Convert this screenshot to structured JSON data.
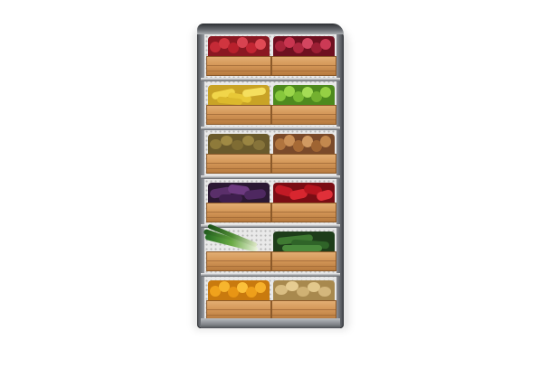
{
  "image": {
    "subject": "produce-display-rack",
    "rows": [
      {
        "left_produce": "red-apples",
        "right_produce": "red-apples"
      },
      {
        "left_produce": "bananas",
        "right_produce": "green-apples"
      },
      {
        "left_produce": "kiwis",
        "right_produce": "pears"
      },
      {
        "left_produce": "eggplants",
        "right_produce": "red-peppers"
      },
      {
        "left_produce": "leeks",
        "right_produce": "zucchini"
      },
      {
        "left_produce": "oranges",
        "right_produce": "potatoes"
      }
    ],
    "colors": {
      "crate": "#d49758",
      "frame": "#c9ccd0",
      "pegboard": "#e9e9e9",
      "background": "#ffffff"
    }
  }
}
